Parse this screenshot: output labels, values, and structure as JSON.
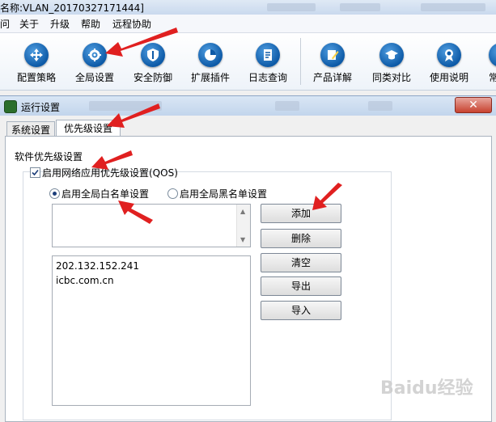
{
  "app": {
    "title": "名称:VLAN_20170327171444]",
    "menu": [
      "问",
      "关于",
      "升级",
      "帮助",
      "远程协助"
    ]
  },
  "toolbar": {
    "items": [
      {
        "label": "配置策略",
        "icon": "network-icon"
      },
      {
        "label": "全局设置",
        "icon": "gear-icon"
      },
      {
        "label": "安全防御",
        "icon": "shield-icon"
      },
      {
        "label": "扩展插件",
        "icon": "pie-chart-icon"
      },
      {
        "label": "日志查询",
        "icon": "document-icon"
      },
      {
        "label": "产品详解",
        "icon": "edit-icon"
      },
      {
        "label": "同类对比",
        "icon": "graduation-cap-icon"
      },
      {
        "label": "使用说明",
        "icon": "badge-icon"
      },
      {
        "label": "常",
        "icon": "more-icon"
      }
    ]
  },
  "dialog": {
    "title": "运行设置",
    "tabs": [
      {
        "label": "系统设置",
        "active": false
      },
      {
        "label": "优先级设置",
        "active": true
      }
    ],
    "group_title": "软件优先级设置",
    "qos_label": "启用网络应用优先级设置(QOS)",
    "qos_checked": true,
    "whitelist_label": "启用全局白名单设置",
    "blacklist_label": "启用全局黑名单设置",
    "whitelist_selected": true,
    "input_value": "",
    "list_entries": [
      "202.132.152.241",
      "icbc.com.cn"
    ],
    "buttons": {
      "add": "添加",
      "delete": "删除",
      "clear": "清空",
      "export": "导出",
      "import": "导入"
    }
  },
  "watermark": "Baidu经验",
  "colors": {
    "accent": "#0d5aa7",
    "annotation_arrow": "#e02020",
    "close_button": "#c7422f"
  }
}
